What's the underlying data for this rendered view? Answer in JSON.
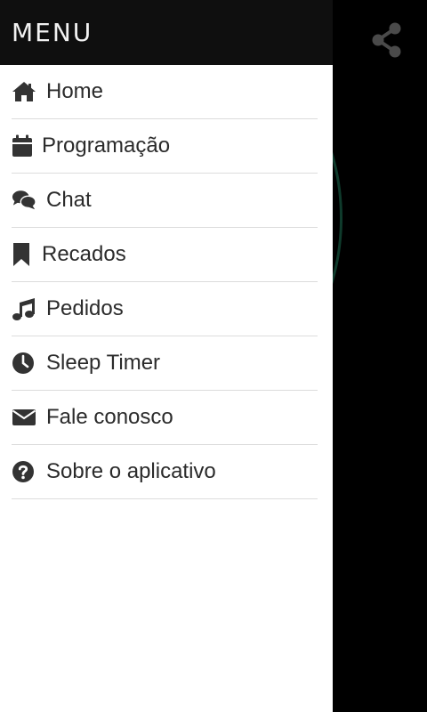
{
  "drawer": {
    "title": "MENU",
    "items": [
      {
        "label": "Home",
        "icon": "home-icon"
      },
      {
        "label": "Programação",
        "icon": "calendar-icon"
      },
      {
        "label": "Chat",
        "icon": "chat-bubbles-icon"
      },
      {
        "label": "Recados",
        "icon": "bookmark-icon"
      },
      {
        "label": "Pedidos",
        "icon": "music-note-icon"
      },
      {
        "label": "Sleep Timer",
        "icon": "clock-icon"
      },
      {
        "label": "Fale conosco",
        "icon": "envelope-icon"
      },
      {
        "label": "Sobre o aplicativo",
        "icon": "question-circle-icon"
      }
    ]
  },
  "background": {
    "share_icon": "share-icon"
  },
  "colors": {
    "header_bg": "#0f0f0f",
    "drawer_bg": "#ffffff",
    "icon_color": "#333333",
    "text_color": "#2b2b2b",
    "divider": "#dcdcdc",
    "accent_ring": "#0f3b2c",
    "share_icon": "#4a4a4a"
  }
}
